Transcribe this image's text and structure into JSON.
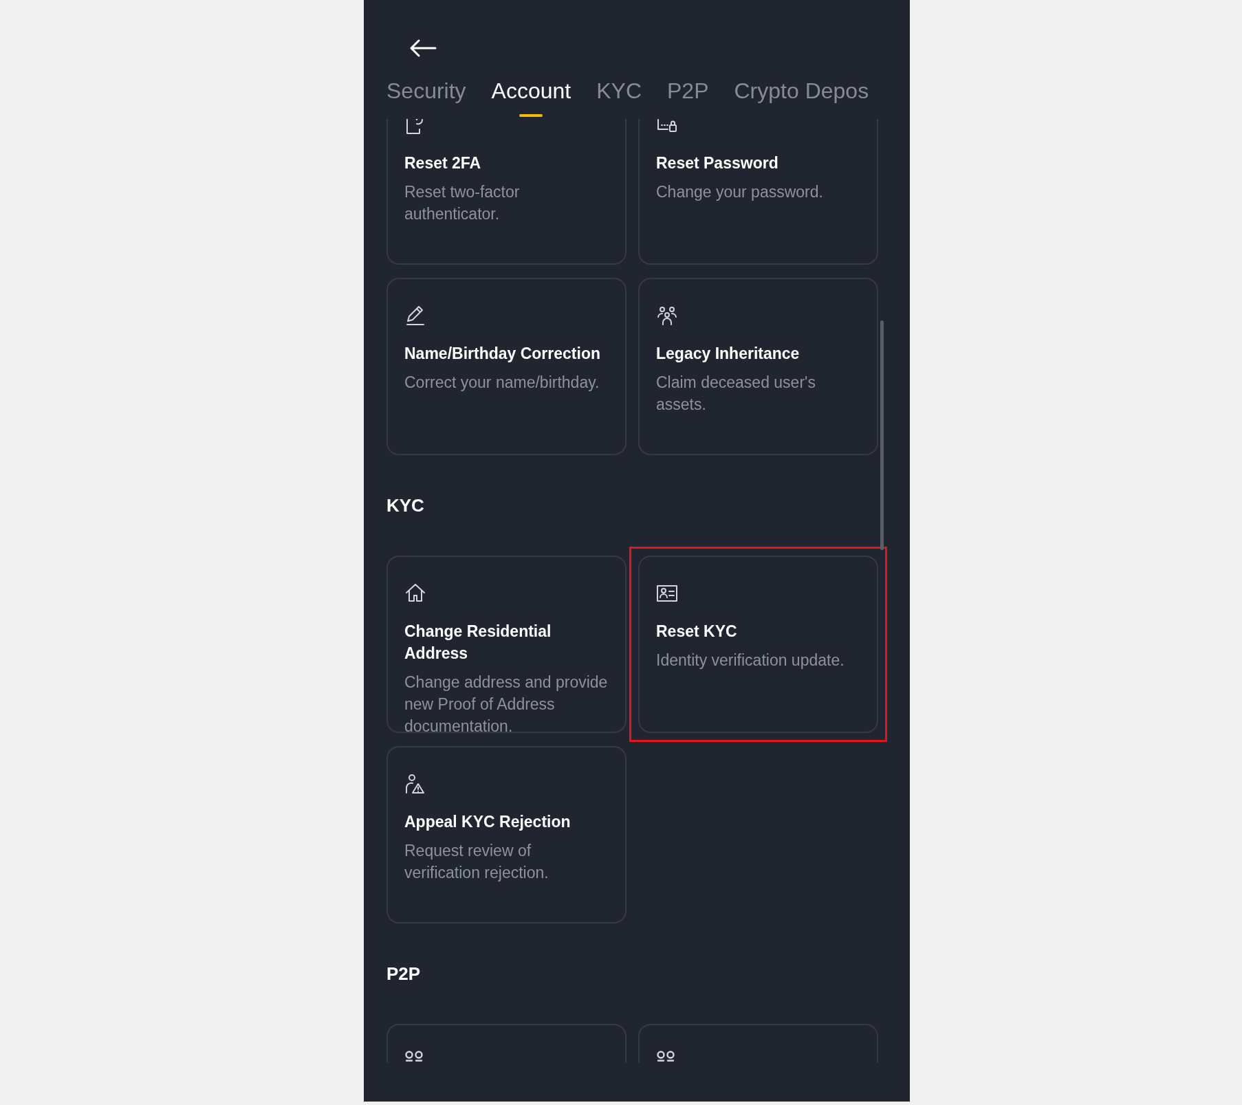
{
  "tabs": [
    {
      "label": "Security",
      "selected": false
    },
    {
      "label": "Account",
      "selected": true
    },
    {
      "label": "KYC",
      "selected": false
    },
    {
      "label": "P2P",
      "selected": false
    },
    {
      "label": "Crypto Depos",
      "selected": false
    }
  ],
  "sections": [
    {
      "cards": [
        {
          "title": "Reset 2FA",
          "description": "Reset two-factor authenticator.",
          "highlighted": false
        },
        {
          "title": "Reset Password",
          "description": "Change your password.",
          "highlighted": false
        },
        {
          "title": "Name/Birthday Correction",
          "description": "Correct your name/birthday.",
          "highlighted": false
        },
        {
          "title": "Legacy Inheritance",
          "description": "Claim deceased user's assets.",
          "highlighted": false
        }
      ]
    },
    {
      "heading": "KYC",
      "cards": [
        {
          "title": "Change Residential Address",
          "description": "Change address and provide new Proof of Address documentation.",
          "highlighted": false
        },
        {
          "title": "Reset KYC",
          "description": "Identity verification update.",
          "highlighted": true
        },
        {
          "title": "Appeal KYC Rejection",
          "description": "Request review of verification rejection.",
          "highlighted": false
        }
      ]
    },
    {
      "heading": "P2P",
      "cards": [
        {
          "highlighted": false
        },
        {
          "highlighted": false
        }
      ]
    }
  ]
}
